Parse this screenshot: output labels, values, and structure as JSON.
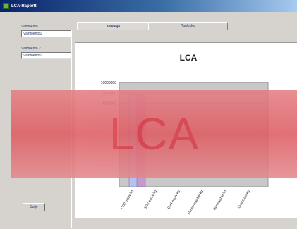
{
  "window": {
    "title": "LCA-Raportti"
  },
  "left": {
    "option1_label": "Vaihtoehto 1",
    "option1_value": "Vaihtoehto1",
    "option2_label": "Vaihtoehto 2",
    "option2_value": "Vaihtoehto1",
    "exit_label": "Sulje"
  },
  "tabs": [
    {
      "label": "Kuvaaja"
    },
    {
      "label": "Taulukko"
    }
  ],
  "overlay": {
    "text": "LCA"
  },
  "chart_data": {
    "type": "bar",
    "title": "LCA",
    "categories": [
      "CO2 equiv kg",
      "SO2 equiv kg",
      "CH4 equiv kg",
      "Nonrenewable kg",
      "Renewable kg",
      "Uusiutuva kg"
    ],
    "ytick_labels": [
      "10000000",
      "9000000",
      "8000000"
    ],
    "ylim": [
      0,
      10000000
    ],
    "series": [
      {
        "values": [
          8800000,
          0,
          0,
          0,
          0,
          0
        ],
        "color": "#b7c1ee"
      },
      {
        "values": [
          8800000,
          0,
          0,
          0,
          0,
          0
        ],
        "color": "#c59acb"
      }
    ],
    "plot_bg": "#c8c8c8",
    "grid": true
  }
}
